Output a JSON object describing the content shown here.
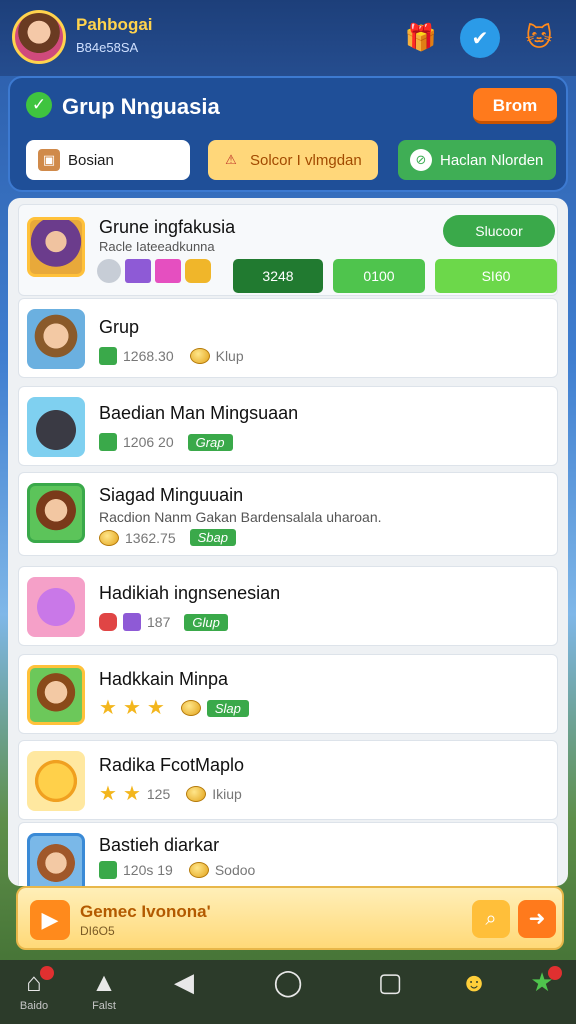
{
  "header": {
    "player_name": "Pahbogai",
    "player_id": "B84e58SA"
  },
  "panel": {
    "title": "Grup Nnguasia",
    "action_label": "Brom",
    "filters": [
      {
        "label": "Bosian",
        "icon": "box-icon"
      },
      {
        "label": "Solcor I vlmgdan",
        "icon": "warning-icon"
      },
      {
        "label": "Haclan Nlorden",
        "icon": "leaf-icon"
      }
    ]
  },
  "featured": {
    "title": "Grune ingfakusia",
    "subtitle": "Racle Iateeadkunna",
    "badge": "Slucoor",
    "bars": [
      "3248",
      "0100",
      "SI60"
    ]
  },
  "items": [
    {
      "title": "Grup",
      "stat": "1268.30",
      "status": "Klup"
    },
    {
      "title": "Baedian Man Mingsuaan",
      "stat": "1206 20",
      "status": "Grap"
    },
    {
      "title": "Siagad Minguuain",
      "subtitle": "Racdion Nanm Gakan Bardensalala uharoan.",
      "stat": "1362.75",
      "status": "Sbap"
    },
    {
      "title": "Hadikiah ingnsenesian",
      "stat": "187",
      "status": "Glup"
    },
    {
      "title": "Hadkkain Minpa",
      "status": "Slap"
    },
    {
      "title": "Radika FcotMaplo",
      "stat": "125",
      "status": "Ikiup"
    },
    {
      "title": "Bastieh diarkar",
      "stat": "120s 19",
      "status": "Sodoo"
    }
  ],
  "banner": {
    "title": "Gemec Ivonona'",
    "subtitle": "DI6O5"
  },
  "nav": [
    {
      "label": "Baido"
    },
    {
      "label": "Falst"
    }
  ],
  "colors": {
    "accent_orange": "#ff7a1c",
    "accent_green": "#3aa94a",
    "panel_blue": "#1f4f98"
  }
}
